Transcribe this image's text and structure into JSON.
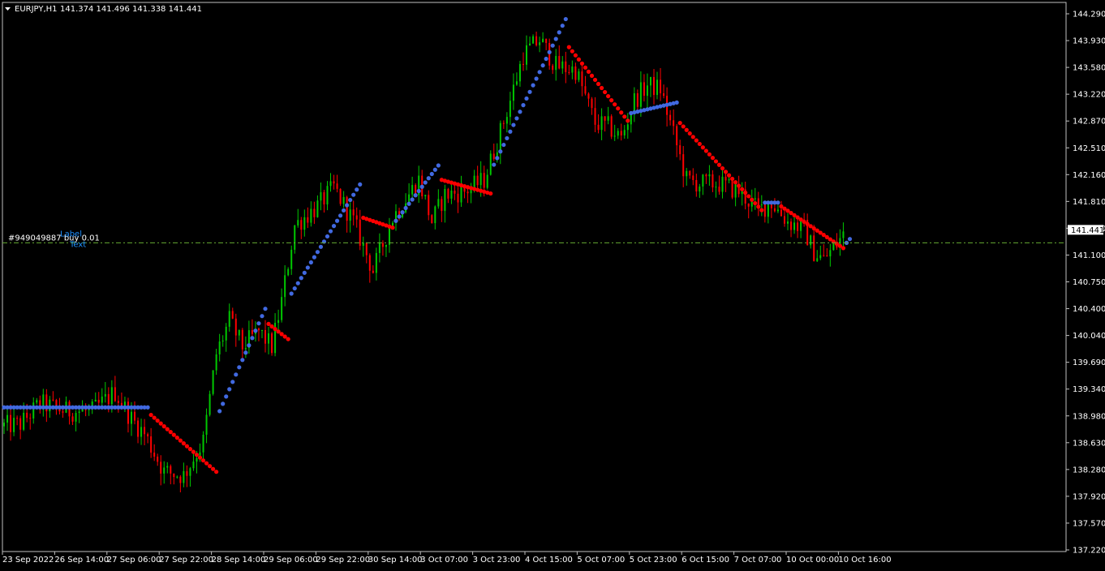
{
  "window": {
    "title": "EURJPY,H1",
    "ohlc_readout": "141.374 141.496 141.338 141.441",
    "menu_icon": "triangle-down-icon"
  },
  "colors": {
    "background": "#000000",
    "frame": "#c0c0c0",
    "text": "#ffffff",
    "bull_candle": "#00c800",
    "bear_candle": "#ff0000",
    "dot_up": "#4169e1",
    "dot_down": "#ff0000",
    "order_line": "#66aa33",
    "label_blue": "#1e90ff"
  },
  "order": {
    "label": "#949049887 buy 0.01",
    "price": 141.27,
    "overlay_labels": [
      "Label",
      "Text"
    ]
  },
  "chart_data": {
    "type": "candlestick",
    "symbol": "EURJPY",
    "timeframe": "H1",
    "ylim": [
      137.22,
      144.29
    ],
    "y_ticks": [
      137.22,
      137.57,
      137.92,
      138.28,
      138.63,
      138.98,
      139.34,
      139.69,
      140.04,
      140.4,
      140.75,
      141.1,
      141.45,
      141.81,
      142.16,
      142.51,
      142.87,
      143.22,
      143.58,
      143.93,
      144.29
    ],
    "y_tick_labels": [
      "137.220",
      "137.570",
      "137.920",
      "138.280",
      "138.630",
      "138.980",
      "139.340",
      "139.690",
      "140.040",
      "140.400",
      "140.750",
      "141.100",
      "141.450",
      "141.810",
      "142.160",
      "142.510",
      "142.870",
      "143.220",
      "143.580",
      "143.930",
      "144.290"
    ],
    "x_tick_labels": [
      "23 Sep 2022",
      "26 Sep 14:00",
      "27 Sep 06:00",
      "27 Sep 22:00",
      "28 Sep 14:00",
      "29 Sep 06:00",
      "29 Sep 22:00",
      "30 Sep 14:00",
      "3 Oct 07:00",
      "3 Oct 23:00",
      "4 Oct 15:00",
      "5 Oct 07:00",
      "5 Oct 23:00",
      "6 Oct 15:00",
      "7 Oct 07:00",
      "10 Oct 00:00",
      "10 Oct 16:00"
    ],
    "current_price": 141.441,
    "current_price_label": "141.441",
    "bars_between_ticks": 16,
    "bars_after_last_tick": 1,
    "price_path": [
      [
        0,
        138.85
      ],
      [
        6,
        138.88
      ],
      [
        12,
        139.15
      ],
      [
        20,
        139.05
      ],
      [
        28,
        139.05
      ],
      [
        35,
        139.3
      ],
      [
        40,
        138.95
      ],
      [
        44,
        138.75
      ],
      [
        50,
        138.25
      ],
      [
        56,
        138.2
      ],
      [
        62,
        138.65
      ],
      [
        66,
        139.8
      ],
      [
        70,
        140.25
      ],
      [
        74,
        139.9
      ],
      [
        79,
        140.1
      ],
      [
        83,
        139.9
      ],
      [
        86,
        140.5
      ],
      [
        90,
        141.5
      ],
      [
        97,
        141.75
      ],
      [
        102,
        142.0
      ],
      [
        108,
        141.55
      ],
      [
        114,
        140.9
      ],
      [
        120,
        141.6
      ],
      [
        124,
        141.85
      ],
      [
        128,
        142.1
      ],
      [
        132,
        141.55
      ],
      [
        136,
        141.9
      ],
      [
        142,
        141.95
      ],
      [
        148,
        142.1
      ],
      [
        152,
        142.6
      ],
      [
        156,
        143.15
      ],
      [
        160,
        143.75
      ],
      [
        165,
        143.95
      ],
      [
        170,
        143.6
      ],
      [
        176,
        143.55
      ],
      [
        182,
        142.85
      ],
      [
        186,
        142.8
      ],
      [
        190,
        142.65
      ],
      [
        194,
        143.15
      ],
      [
        198,
        143.35
      ],
      [
        202,
        143.3
      ],
      [
        206,
        142.7
      ],
      [
        210,
        142.1
      ],
      [
        214,
        142.05
      ],
      [
        220,
        142.05
      ],
      [
        226,
        141.95
      ],
      [
        232,
        141.7
      ],
      [
        236,
        141.8
      ],
      [
        241,
        141.55
      ],
      [
        246,
        141.45
      ],
      [
        249,
        141.15
      ],
      [
        252,
        141.05
      ],
      [
        256,
        141.25
      ],
      [
        259,
        141.44
      ]
    ],
    "indicator_segments": [
      {
        "trend": "up",
        "from": 0,
        "to": 44,
        "y": [
          139.1,
          139.1
        ]
      },
      {
        "trend": "down",
        "from": 45,
        "to": 65,
        "y": [
          139.0,
          138.25
        ]
      },
      {
        "trend": "up",
        "from": 66,
        "to": 80,
        "y": [
          139.05,
          140.4
        ]
      },
      {
        "trend": "down",
        "from": 81,
        "to": 87,
        "y": [
          140.2,
          140.0
        ]
      },
      {
        "trend": "up",
        "from": 88,
        "to": 109,
        "y": [
          140.6,
          142.04
        ]
      },
      {
        "trend": "down",
        "from": 110,
        "to": 119,
        "y": [
          141.6,
          141.47
        ]
      },
      {
        "trend": "up",
        "from": 120,
        "to": 133,
        "y": [
          141.56,
          142.29
        ]
      },
      {
        "trend": "down",
        "from": 134,
        "to": 149,
        "y": [
          142.1,
          141.92
        ]
      },
      {
        "trend": "up",
        "from": 150,
        "to": 172,
        "y": [
          142.3,
          144.22
        ]
      },
      {
        "trend": "down",
        "from": 173,
        "to": 191,
        "y": [
          143.85,
          142.88
        ]
      },
      {
        "trend": "up",
        "from": 192,
        "to": 206,
        "y": [
          142.98,
          143.12
        ]
      },
      {
        "trend": "down",
        "from": 207,
        "to": 232,
        "y": [
          142.85,
          141.7
        ]
      },
      {
        "trend": "up",
        "from": 233,
        "to": 237,
        "y": [
          141.8,
          141.8
        ]
      },
      {
        "trend": "down",
        "from": 238,
        "to": 257,
        "y": [
          141.75,
          141.2
        ]
      },
      {
        "trend": "up",
        "from": 258,
        "to": 259,
        "y": [
          141.27,
          141.32
        ]
      }
    ]
  }
}
